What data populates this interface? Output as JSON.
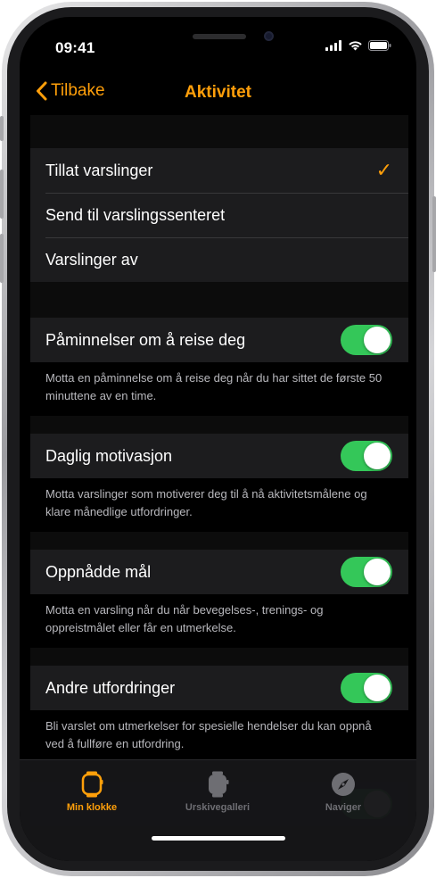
{
  "status": {
    "time": "09:41"
  },
  "nav": {
    "back_label": "Tilbake",
    "title": "Aktivitet"
  },
  "notification_options": [
    {
      "label": "Tillat varslinger",
      "selected": true
    },
    {
      "label": "Send til varslingssenteret",
      "selected": false
    },
    {
      "label": "Varslinger av",
      "selected": false
    }
  ],
  "check_mark": "✓",
  "toggles": [
    {
      "label": "Påminnelser om å reise deg",
      "on": true,
      "description": "Motta en påminnelse om å reise deg når du har sittet de første 50 minuttene av en time."
    },
    {
      "label": "Daglig motivasjon",
      "on": true,
      "description": "Motta varslinger som motiverer deg til å nå aktivitetsmålene og klare månedlige utfordringer."
    },
    {
      "label": "Oppnådde mål",
      "on": true,
      "description": "Motta en varsling når du når bevegelses-, trenings- og oppreistmålet eller får en utmerkelse."
    },
    {
      "label": "Andre utfordringer",
      "on": true,
      "description": "Bli varslet om utmerkelser for spesielle hendelser du kan oppnå ved å fullføre en utfordring."
    }
  ],
  "tabs": [
    {
      "label": "Min klokke",
      "icon": "watch-icon",
      "active": true
    },
    {
      "label": "Urskivegalleri",
      "icon": "watch-face-icon",
      "active": false
    },
    {
      "label": "Naviger",
      "icon": "compass-icon",
      "active": false
    }
  ],
  "colors": {
    "accent": "#ff9f0a",
    "toggle_on": "#34c759",
    "background": "#000000",
    "cell": "#1c1c1e"
  }
}
